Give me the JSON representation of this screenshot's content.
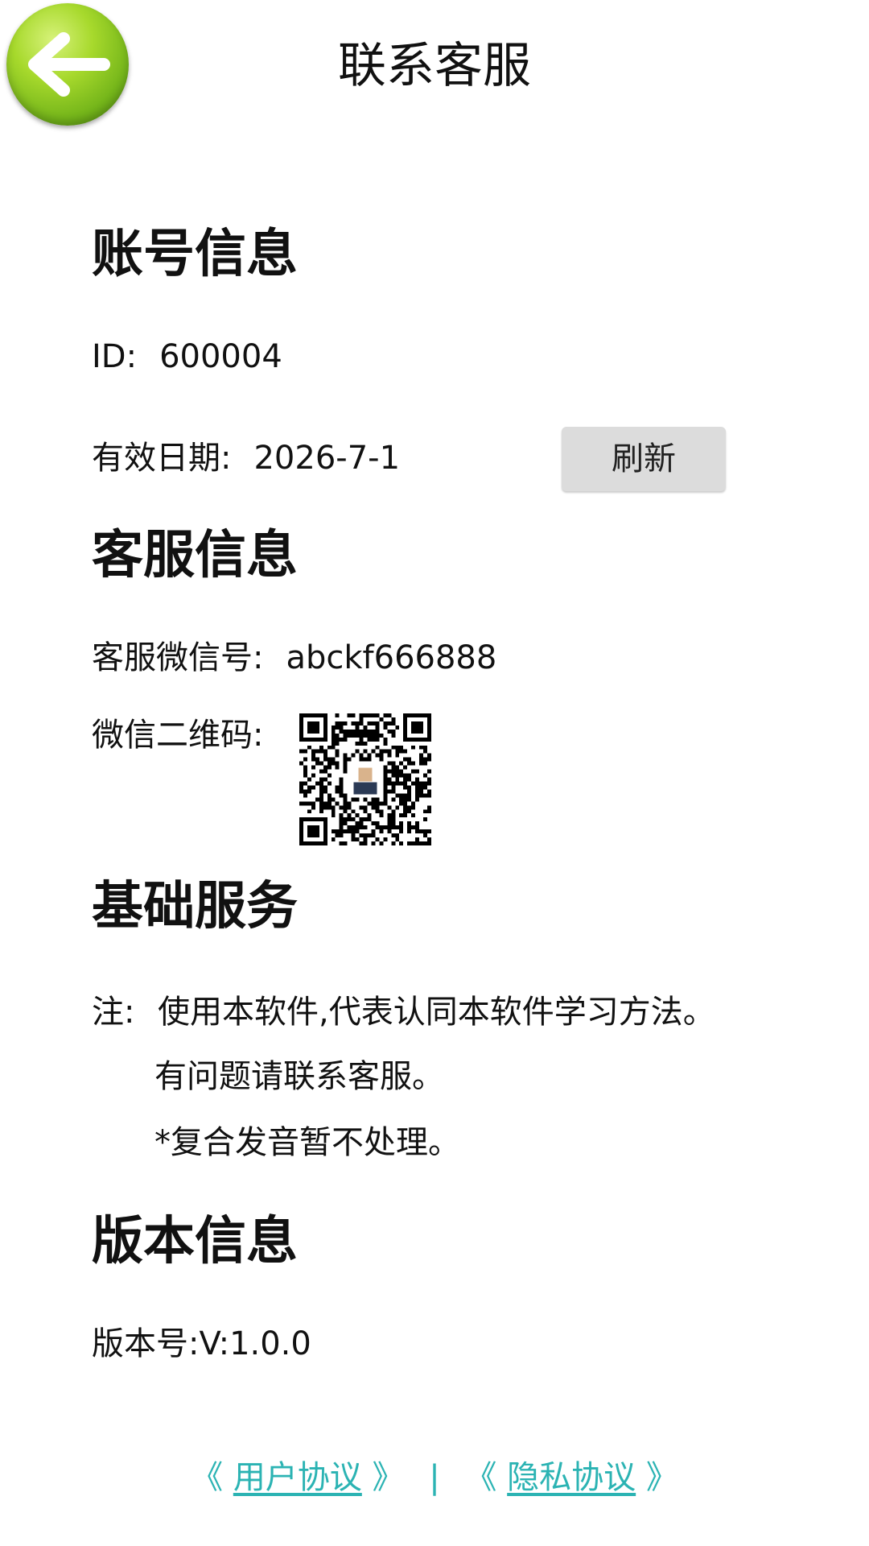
{
  "header": {
    "title": "联系客服",
    "back_icon": "arrow-left-icon"
  },
  "account": {
    "title": "账号信息",
    "id_label": "ID:",
    "id_value": "600004",
    "expiry_label": "有效日期:",
    "expiry_value": "2026-7-1",
    "refresh_label": "刷新"
  },
  "service": {
    "title": "客服信息",
    "wechat_label": "客服微信号:",
    "wechat_value": "abckf666888",
    "qr_label": "微信二维码:"
  },
  "basic": {
    "title": "基础服务",
    "note_prefix": "注:",
    "note_line1": "使用本软件,代表认同本软件学习方法。",
    "note_line2": "有问题请联系客服。",
    "note_line3": "*复合发音暂不处理。"
  },
  "version": {
    "title": "版本信息",
    "label": "版本号:",
    "value": "V:1.0.0"
  },
  "footer": {
    "left_open": "《",
    "user_agreement": "用户协议",
    "left_close": "》",
    "separator": "|",
    "right_open": "《",
    "privacy_agreement": "隐私协议",
    "right_close": "》"
  },
  "colors": {
    "link": "#2bb3b3",
    "back_button": "#8cc63f",
    "refresh_bg": "#dcdcdc"
  }
}
